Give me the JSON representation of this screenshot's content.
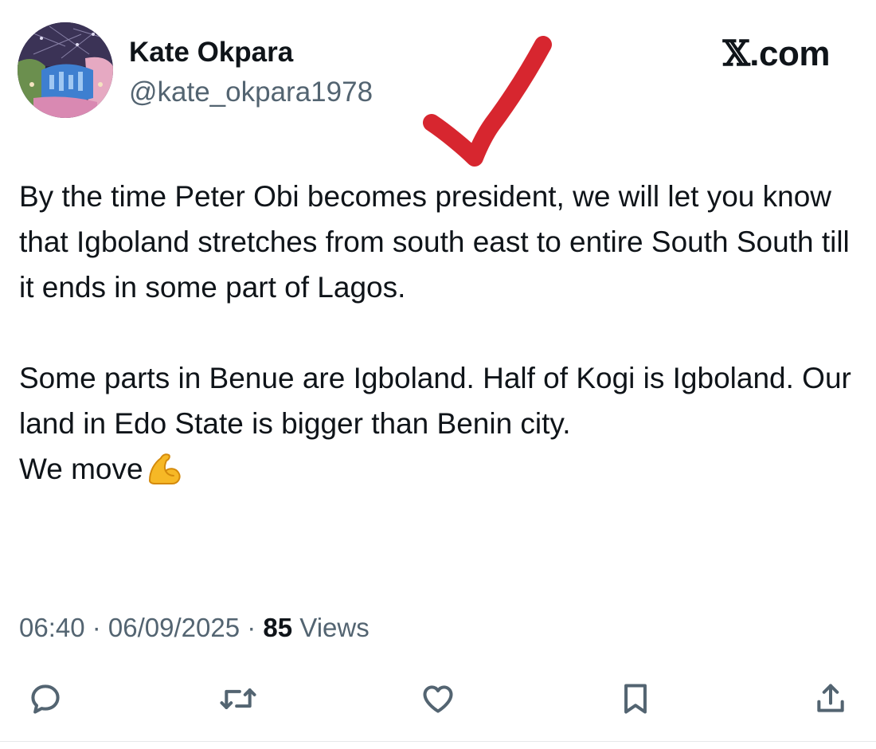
{
  "author": {
    "display_name": "Kate Okpara",
    "handle": "@kate_okpara1978",
    "avatar_icon": "puzzle-avatar-icon"
  },
  "site": {
    "logo_mark": "𝕏",
    "label": ".com"
  },
  "annotation": {
    "icon": "red-arrow-icon",
    "color": "#d7262f"
  },
  "tweet": {
    "text": "By the time Peter Obi becomes president, we will let you know that Igboland stretches from south east to entire South South till it ends in some part of Lagos.\n\nSome parts in Benue are Igboland. Half of Kogi is Igboland. Our land in Edo State is bigger than Benin city.\nWe move",
    "emoji": "flexed-biceps-icon"
  },
  "meta": {
    "time": "06:40",
    "separator": " · ",
    "date": "06/09/2025",
    "views_count": "85",
    "views_label": " Views"
  },
  "actions": [
    {
      "name": "reply-button",
      "icon": "comment-icon"
    },
    {
      "name": "repost-button",
      "icon": "repost-icon"
    },
    {
      "name": "like-button",
      "icon": "heart-icon"
    },
    {
      "name": "bookmark-button",
      "icon": "bookmark-icon"
    },
    {
      "name": "share-button",
      "icon": "share-icon"
    }
  ],
  "colors": {
    "text_primary": "#0f1419",
    "text_secondary": "#536471",
    "icon_gray": "#536471"
  }
}
